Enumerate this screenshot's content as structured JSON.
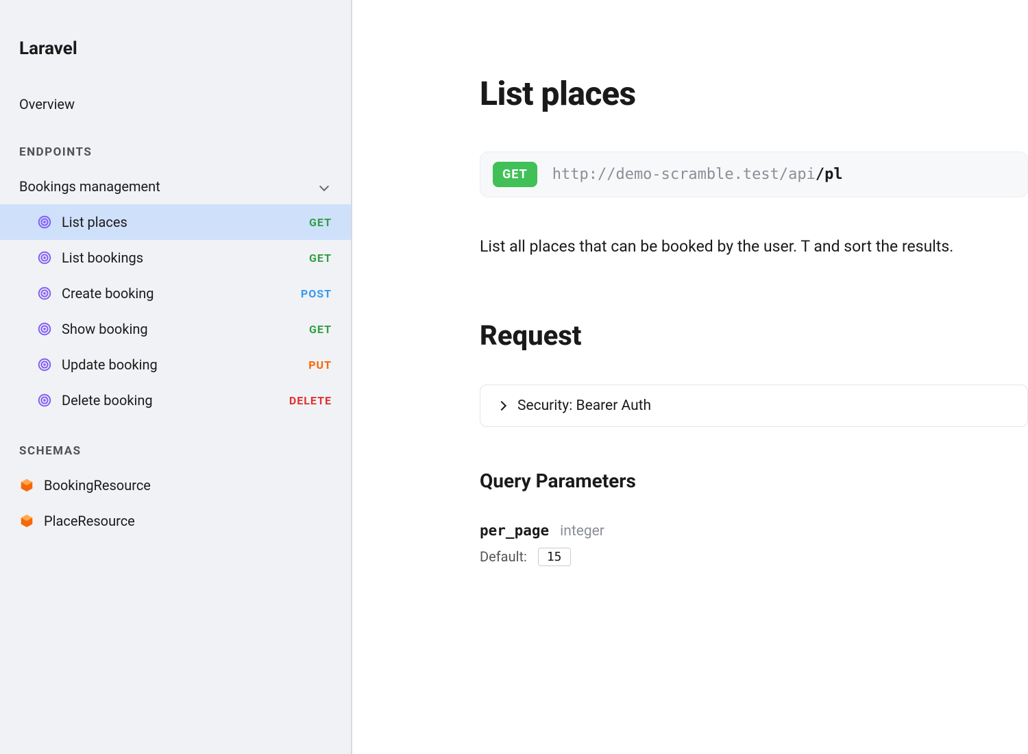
{
  "sidebar": {
    "brand": "Laravel",
    "overview": "Overview",
    "endpoints_label": "ENDPOINTS",
    "group": "Bookings management",
    "endpoints": [
      {
        "label": "List places",
        "method": "GET",
        "cls": "m-get",
        "active": true
      },
      {
        "label": "List bookings",
        "method": "GET",
        "cls": "m-get",
        "active": false
      },
      {
        "label": "Create booking",
        "method": "POST",
        "cls": "m-post",
        "active": false
      },
      {
        "label": "Show booking",
        "method": "GET",
        "cls": "m-get",
        "active": false
      },
      {
        "label": "Update booking",
        "method": "PUT",
        "cls": "m-put",
        "active": false
      },
      {
        "label": "Delete booking",
        "method": "DELETE",
        "cls": "m-delete",
        "active": false
      }
    ],
    "schemas_label": "SCHEMAS",
    "schemas": [
      "BookingResource",
      "PlaceResource"
    ]
  },
  "main": {
    "title": "List places",
    "method": "GET",
    "url_base": "http://demo-scramble.test/api",
    "url_path_sep": "/",
    "url_path": "pl",
    "description": "List all places that can be booked by the user. T and sort the results.",
    "request_heading": "Request",
    "security": "Security: Bearer Auth",
    "query_heading": "Query Parameters",
    "param": {
      "name": "per_page",
      "type": "integer",
      "default_label": "Default:",
      "default_value": "15"
    }
  }
}
